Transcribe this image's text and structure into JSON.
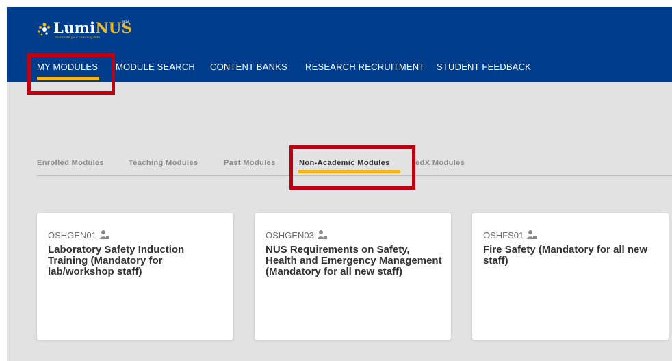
{
  "logo": {
    "brand_part1": "Lumi",
    "brand_part2": "NUS",
    "beta": "BETA",
    "tagline": "Illuminate your Learning Path"
  },
  "nav": {
    "items": [
      {
        "label": "MY MODULES"
      },
      {
        "label": "MODULE SEARCH"
      },
      {
        "label": "CONTENT BANKS"
      },
      {
        "label": "RESEARCH RECRUITMENT"
      },
      {
        "label": "STUDENT FEEDBACK"
      }
    ],
    "active": "MY MODULES"
  },
  "subtabs": {
    "items": [
      {
        "label": "Enrolled Modules"
      },
      {
        "label": "Teaching Modules"
      },
      {
        "label": "Past Modules"
      },
      {
        "label": "Non-Academic Modules"
      },
      {
        "label": "edX Modules"
      }
    ],
    "active": "Non-Academic Modules"
  },
  "cards": [
    {
      "code": "OSHGEN01",
      "title": "Laboratory Safety Induction Training (Mandatory for lab/workshop staff)"
    },
    {
      "code": "OSHGEN03",
      "title": "NUS Requirements on Safety, Health and Emergency Management (Mandatory for all new staff)"
    },
    {
      "code": "OSHFS01",
      "title": "Fire Safety (Mandatory for all new staff)"
    }
  ],
  "colors": {
    "header_bg": "#003d8c",
    "accent": "#f2b614",
    "page_bg": "#e2e2e2",
    "highlight_box": "#c00010"
  }
}
